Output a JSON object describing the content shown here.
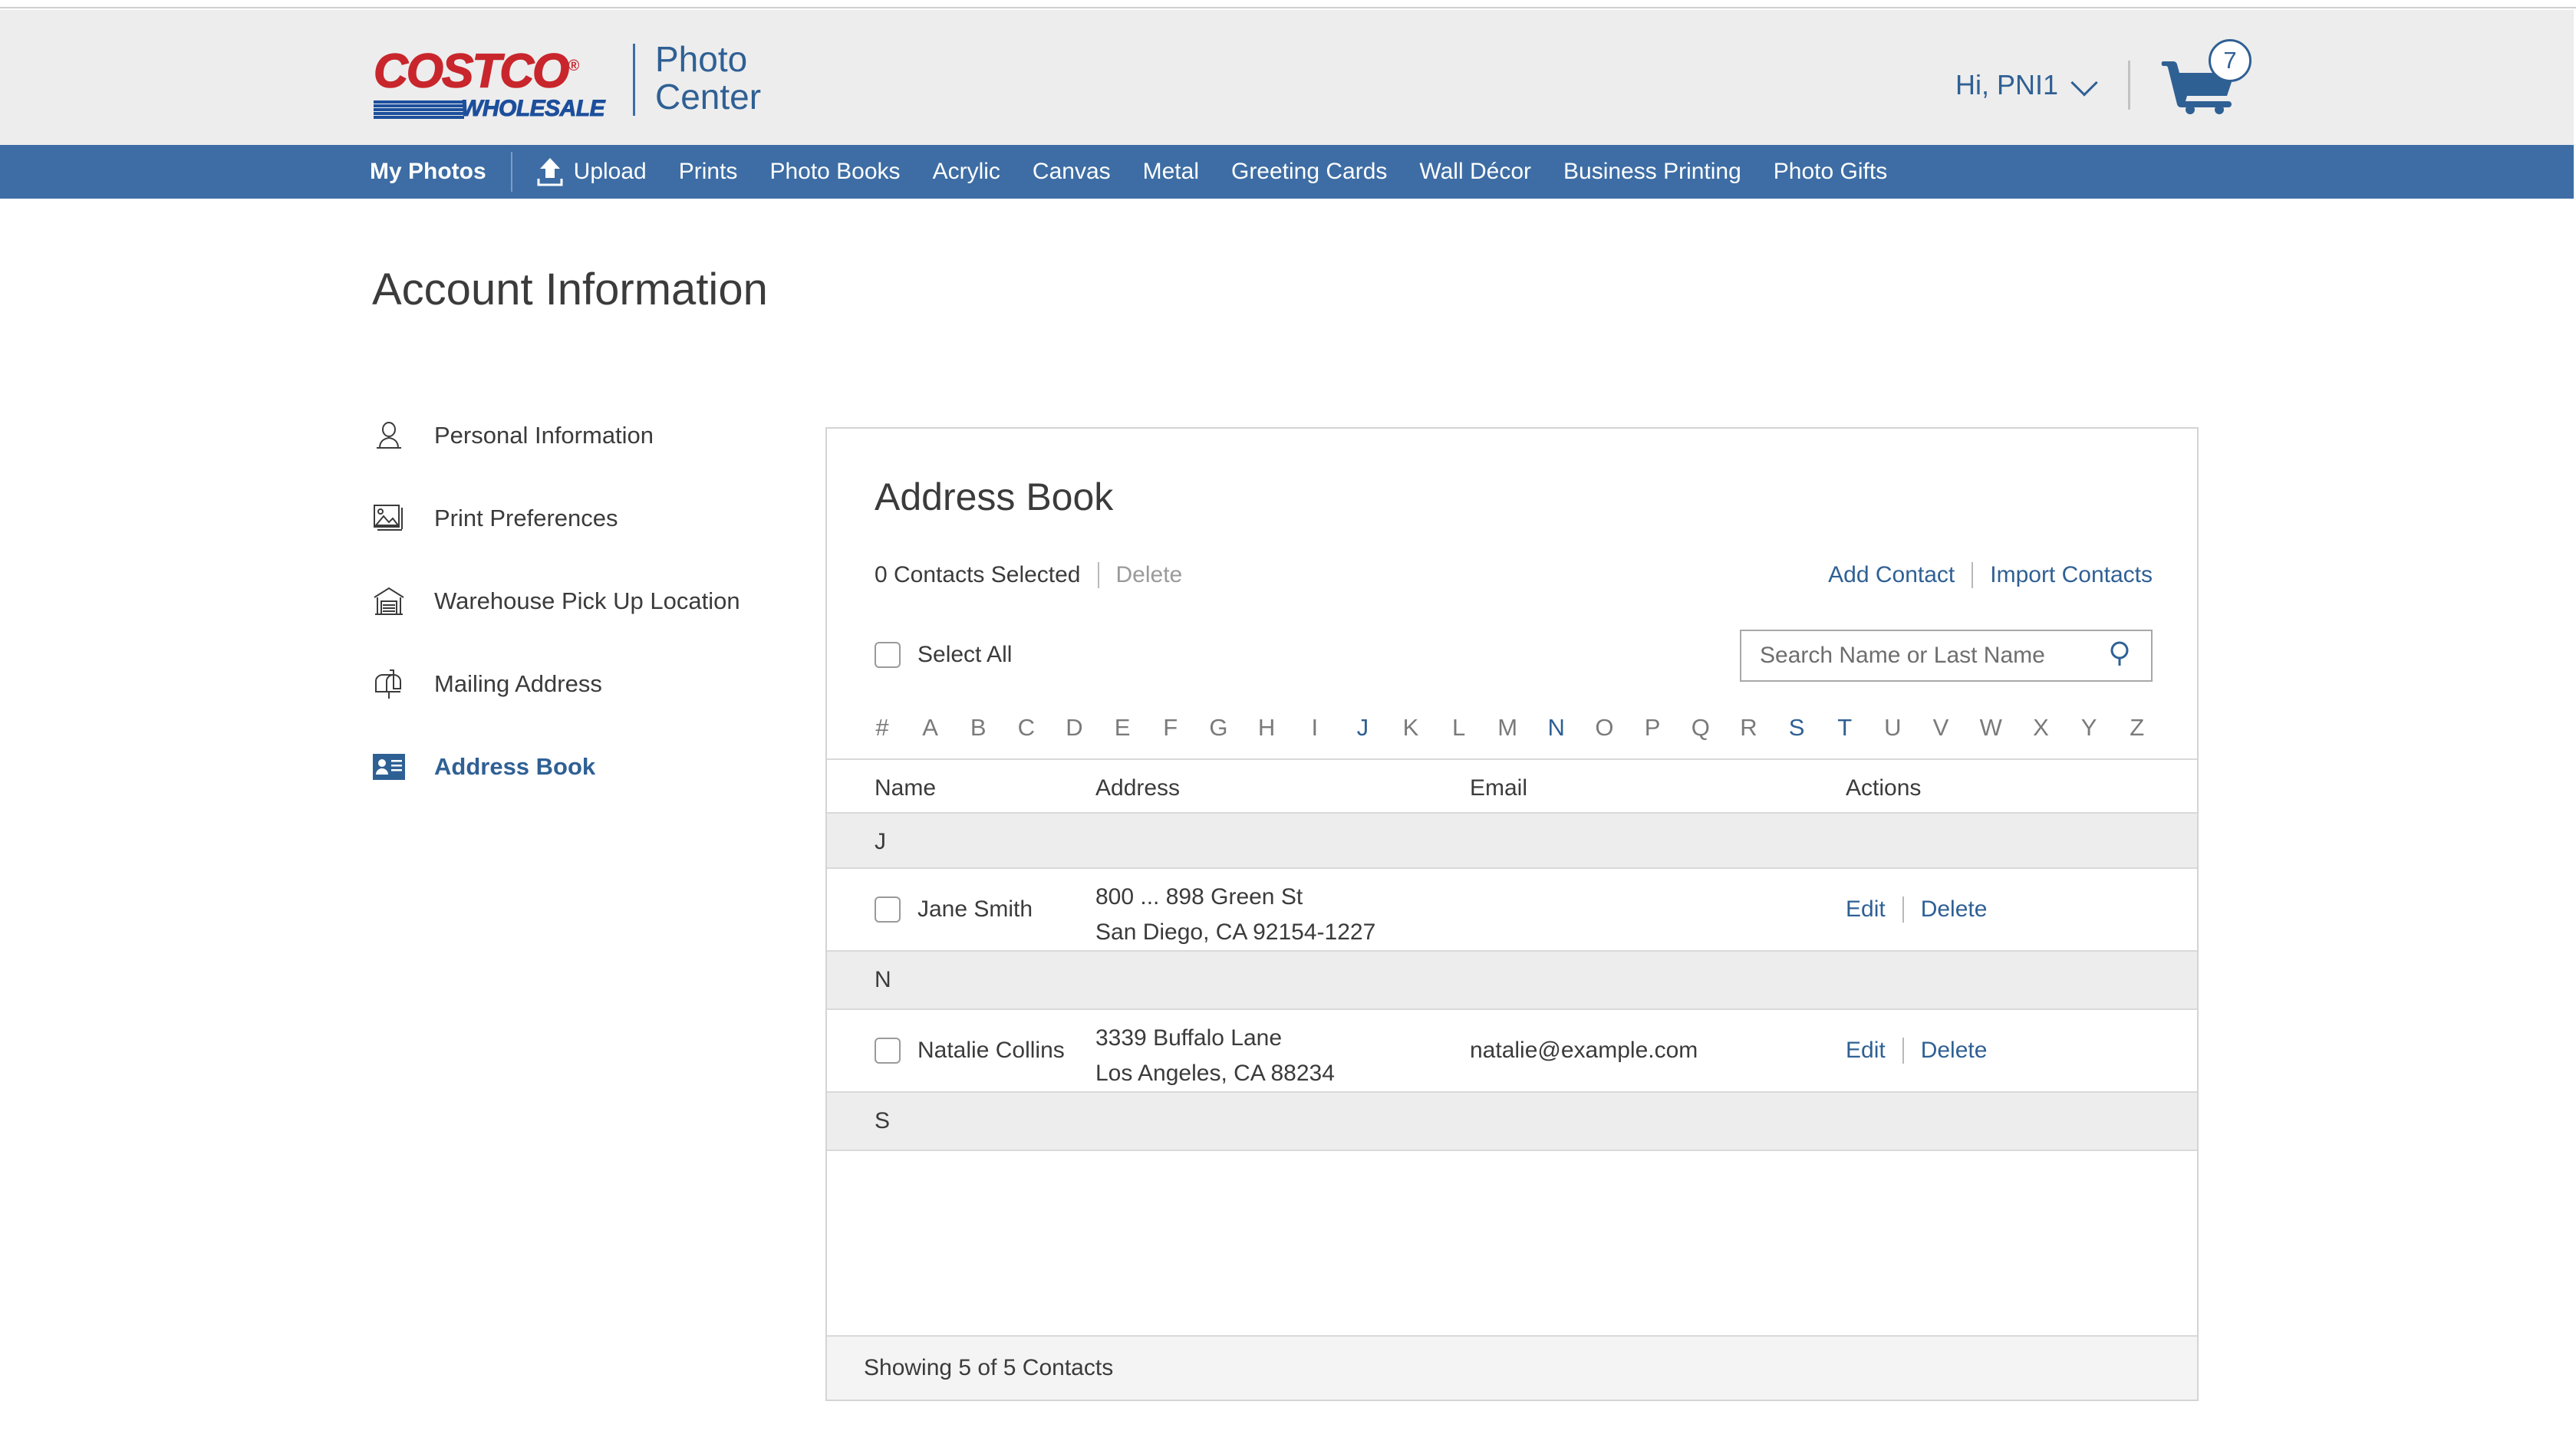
{
  "header": {
    "logo_brand": "COSTCO",
    "logo_reg": "®",
    "logo_wholesale": "WHOLESALE",
    "logo_sub_line1": "Photo",
    "logo_sub_line2": "Center",
    "greeting": "Hi, PNI1",
    "greeting_chevron_icon": "chevron-down-icon",
    "cart_icon": "shopping-cart-icon",
    "cart_count": "7"
  },
  "nav": {
    "primary_label": "My Photos",
    "upload_icon": "upload-icon",
    "upload_label": "Upload",
    "items": [
      {
        "label": "Prints"
      },
      {
        "label": "Photo Books"
      },
      {
        "label": "Acrylic"
      },
      {
        "label": "Canvas"
      },
      {
        "label": "Metal"
      },
      {
        "label": "Greeting Cards"
      },
      {
        "label": "Wall Décor"
      },
      {
        "label": "Business Printing"
      },
      {
        "label": "Photo Gifts"
      }
    ]
  },
  "page": {
    "title": "Account Information"
  },
  "sidebar": {
    "items": [
      {
        "label": "Personal Information",
        "icon": "person-icon",
        "active": false
      },
      {
        "label": "Print Preferences",
        "icon": "image-icon",
        "active": false
      },
      {
        "label": "Warehouse Pick Up Location",
        "icon": "warehouse-icon",
        "active": false
      },
      {
        "label": "Mailing Address",
        "icon": "mailbox-icon",
        "active": false
      },
      {
        "label": "Address Book",
        "icon": "contact-card-icon",
        "active": true
      }
    ]
  },
  "address_book": {
    "title": "Address Book",
    "selected_text": "0 Contacts Selected",
    "delete_label": "Delete",
    "add_contact_label": "Add Contact",
    "import_contacts_label": "Import Contacts",
    "select_all_label": "Select All",
    "search": {
      "placeholder": "Search Name or Last Name",
      "value": "",
      "icon": "search-icon"
    },
    "alpha_filter": {
      "letters": [
        "#",
        "A",
        "B",
        "C",
        "D",
        "E",
        "F",
        "G",
        "H",
        "I",
        "J",
        "K",
        "L",
        "M",
        "N",
        "O",
        "P",
        "Q",
        "R",
        "S",
        "T",
        "U",
        "V",
        "W",
        "X",
        "Y",
        "Z"
      ],
      "active_letters": [
        "J",
        "N",
        "S",
        "T"
      ]
    },
    "columns": {
      "name": "Name",
      "address": "Address",
      "email": "Email",
      "actions": "Actions"
    },
    "groups": [
      {
        "letter": "J",
        "contacts": [
          {
            "name": "Jane Smith",
            "address_line1": "800 ... 898 Green St",
            "address_line2": "San Diego, CA 92154-1227",
            "email": "",
            "edit_label": "Edit",
            "delete_label": "Delete",
            "checked": false
          }
        ]
      },
      {
        "letter": "N",
        "contacts": [
          {
            "name": "Natalie Collins",
            "address_line1": "3339 Buffalo Lane",
            "address_line2": "Los Angeles, CA 88234",
            "email": "natalie@example.com",
            "edit_label": "Edit",
            "delete_label": "Delete",
            "checked": false
          }
        ]
      },
      {
        "letter": "S",
        "contacts": []
      }
    ],
    "footer_text": "Showing 5 of 5 Contacts"
  },
  "colors": {
    "brand_red": "#c8262c",
    "brand_blue": "#1c4f9c",
    "nav_blue": "#3d6da4",
    "link_blue": "#2f6094",
    "header_gray": "#ededed"
  }
}
